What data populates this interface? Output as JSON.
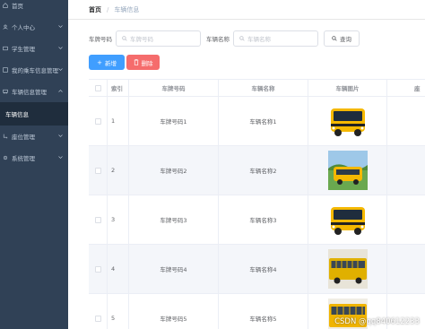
{
  "sidebar": {
    "items": [
      {
        "label": "首页",
        "icon": "home-icon"
      },
      {
        "label": "个人中心",
        "icon": "user-icon"
      },
      {
        "label": "学生管理",
        "icon": "student-icon"
      },
      {
        "label": "我的乘车信息管理",
        "icon": "ride-icon"
      },
      {
        "label": "车辆信息管理",
        "icon": "bus-icon"
      },
      {
        "label": "车辆信息",
        "icon": ""
      },
      {
        "label": "座位管理",
        "icon": "seat-icon"
      },
      {
        "label": "系统管理",
        "icon": "system-icon"
      }
    ]
  },
  "breadcrumb": {
    "home": "首页",
    "separator": "/",
    "current": "车辆信息"
  },
  "search": {
    "plate_label": "车牌号码",
    "plate_placeholder": "车牌号码",
    "name_label": "车辆名称",
    "name_placeholder": "车辆名称",
    "query_label": "查询"
  },
  "actions": {
    "add_label": "新增",
    "delete_label": "删除"
  },
  "table": {
    "columns": [
      "索引",
      "车牌号码",
      "车辆名称",
      "车辆图片",
      "座"
    ],
    "rows": [
      {
        "index": "1",
        "plate": "车牌号码1",
        "name": "车辆名称1",
        "image": "yellow-bus-image"
      },
      {
        "index": "2",
        "plate": "车牌号码2",
        "name": "车辆名称2",
        "image": "bus-landscape-image"
      },
      {
        "index": "3",
        "plate": "车牌号码3",
        "name": "车辆名称3",
        "image": "yellow-bus-image"
      },
      {
        "index": "4",
        "plate": "车牌号码4",
        "name": "车辆名称4",
        "image": "bus-side-image"
      },
      {
        "index": "5",
        "plate": "车牌号码5",
        "name": "车辆名称5",
        "image": "bus-side-image"
      }
    ]
  },
  "watermark": "CSDN @qq840612233",
  "colors": {
    "sidebar_bg": "#304156",
    "primary": "#409eff",
    "danger": "#f56c6c",
    "bus_yellow": "#f5b800"
  }
}
